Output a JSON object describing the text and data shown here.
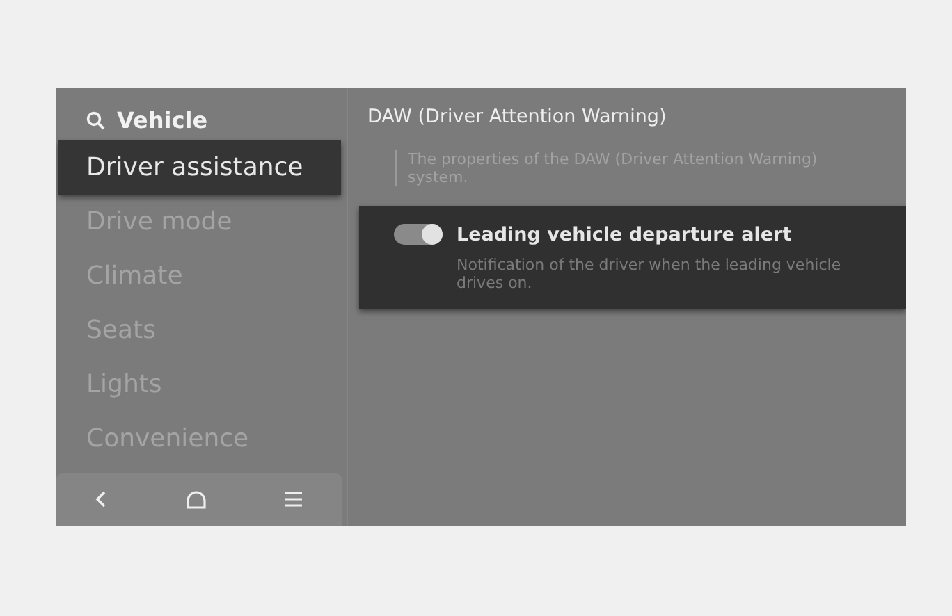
{
  "search": {
    "label": "Vehicle"
  },
  "sidebar": {
    "items": [
      {
        "label": "Driver assistance",
        "selected": true
      },
      {
        "label": "Drive mode",
        "selected": false
      },
      {
        "label": "Climate",
        "selected": false
      },
      {
        "label": "Seats",
        "selected": false
      },
      {
        "label": "Lights",
        "selected": false
      },
      {
        "label": "Convenience",
        "selected": false
      }
    ]
  },
  "panel": {
    "title": "DAW (Driver Attention Warning)",
    "description": "The properties of the DAW (Driver Attention Warning) system.",
    "settings": [
      {
        "label": "Leading vehicle departure alert",
        "description": "Notification of the driver when the leading vehicle drives on.",
        "on": true
      }
    ]
  }
}
